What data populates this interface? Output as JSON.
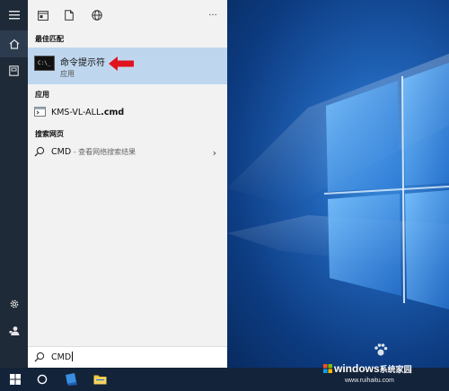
{
  "panel": {
    "best_match_header": "最佳匹配",
    "best_match": {
      "title": "命令提示符",
      "subtitle": "应用"
    },
    "apps_header": "应用",
    "app_item": {
      "name": "KMS-VL-ALL",
      "ext": ".cmd"
    },
    "web_header": "搜索网页",
    "web_item": {
      "query": "CMD",
      "hint": " - 查看网络搜索结果"
    },
    "more_label": "···"
  },
  "search": {
    "value": "CMD"
  },
  "colors": {
    "highlight": "#bfd7ee",
    "arrow": "#e0141e",
    "rail": "#1f2a38",
    "taskbar": "#13233a"
  },
  "watermark": {
    "brand": "windows",
    "brand_cn": "系统家园",
    "url": "www.ruihaitu.com"
  }
}
